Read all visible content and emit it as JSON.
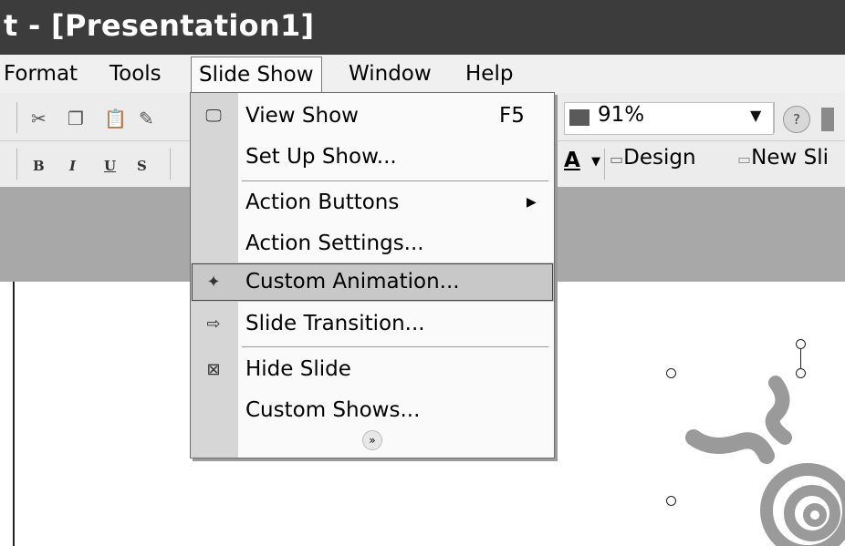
{
  "window": {
    "title": "t - [Presentation1]"
  },
  "menubar": {
    "items": [
      {
        "label": "Format"
      },
      {
        "label": "Tools"
      },
      {
        "label": "Slide Show"
      },
      {
        "label": "Window"
      },
      {
        "label": "Help"
      }
    ]
  },
  "toolbar": {
    "zoom": "91%",
    "format_buttons": [
      "B",
      "I",
      "U",
      "S"
    ],
    "font_color": "A",
    "design_label": "Design",
    "new_slide_label": "New Sli"
  },
  "slide_show_menu": {
    "items": [
      {
        "label": "View Show",
        "shortcut": "F5",
        "icon": "projector-icon"
      },
      {
        "label": "Set Up Show...",
        "icon": ""
      },
      {
        "label": "Action Buttons",
        "icon": "",
        "submenu": true
      },
      {
        "label": "Action Settings...",
        "icon": ""
      },
      {
        "label": "Custom Animation...",
        "icon": "custom-animation-icon",
        "highlighted": true
      },
      {
        "label": "Slide Transition...",
        "icon": "slide-transition-icon"
      },
      {
        "label": "Hide Slide",
        "icon": "hide-slide-icon"
      },
      {
        "label": "Custom Shows...",
        "icon": ""
      }
    ]
  },
  "colors": {
    "title_bar": "#3c3c3c",
    "menu_highlight": "#c8c8c8",
    "icon_gutter": "#d6d6d6",
    "task_band": "#a8a8a8"
  }
}
